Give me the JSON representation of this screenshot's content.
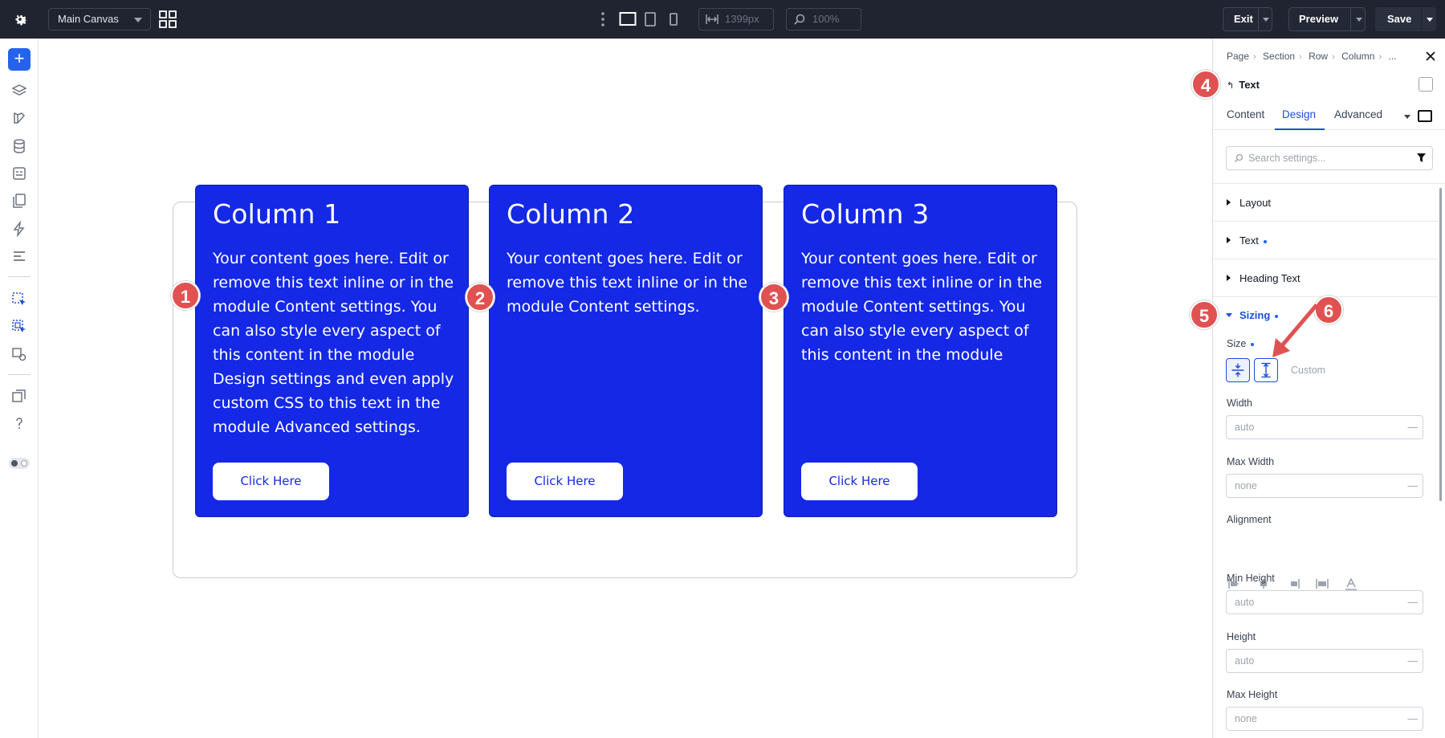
{
  "topbar": {
    "canvas_select": "Main Canvas",
    "width_value": "1399px",
    "zoom_value": "100%",
    "exit_label": "Exit",
    "preview_label": "Preview",
    "save_label": "Save"
  },
  "canvas": {
    "columns": [
      {
        "title": "Column 1",
        "text": "Your content goes here. Edit or remove this text inline or in the module Content settings. You can also style every aspect of this content in the module Design settings and even apply custom CSS to this text in the module Advanced settings.",
        "button": "Click Here",
        "badge": "1"
      },
      {
        "title": "Column 2",
        "text": "Your content goes here. Edit or remove this text inline or in the module Content settings.",
        "button": "Click Here",
        "badge": "2"
      },
      {
        "title": "Column 3",
        "text": "Your content goes here. Edit or remove this text inline or in the module Content settings. You can also style every aspect of this content in the module",
        "button": "Click Here",
        "badge": "3"
      }
    ]
  },
  "panel": {
    "breadcrumbs": [
      "Page",
      "Section",
      "Row",
      "Column",
      "..."
    ],
    "module_title": "Text",
    "tabs": [
      "Content",
      "Design",
      "Advanced"
    ],
    "active_tab": "Design",
    "search_placeholder": "Search settings...",
    "groups": [
      "Layout",
      "Text",
      "Heading Text"
    ],
    "sizing_label": "Sizing",
    "size_label": "Size",
    "size_custom": "Custom",
    "width_label": "Width",
    "width_value": "auto",
    "max_width_label": "Max Width",
    "max_width_value": "none",
    "alignment_label": "Alignment",
    "min_height_label": "Min Height",
    "min_height_value": "auto",
    "height_label": "Height",
    "height_value": "auto",
    "max_height_label": "Max Height",
    "max_height_value": "none",
    "badges": [
      "4",
      "5",
      "6"
    ]
  },
  "colors": {
    "column_bg": "#1428e6",
    "accent": "#2563eb",
    "badge": "#e05252",
    "topbar": "#1f2430"
  },
  "icons": [
    "gear-icon",
    "grid-icon",
    "desktop-icon",
    "tablet-icon",
    "phone-icon",
    "width-icon",
    "zoom-icon",
    "plus-icon",
    "layers-icon",
    "close-icon",
    "filter-icon",
    "search-icon"
  ]
}
